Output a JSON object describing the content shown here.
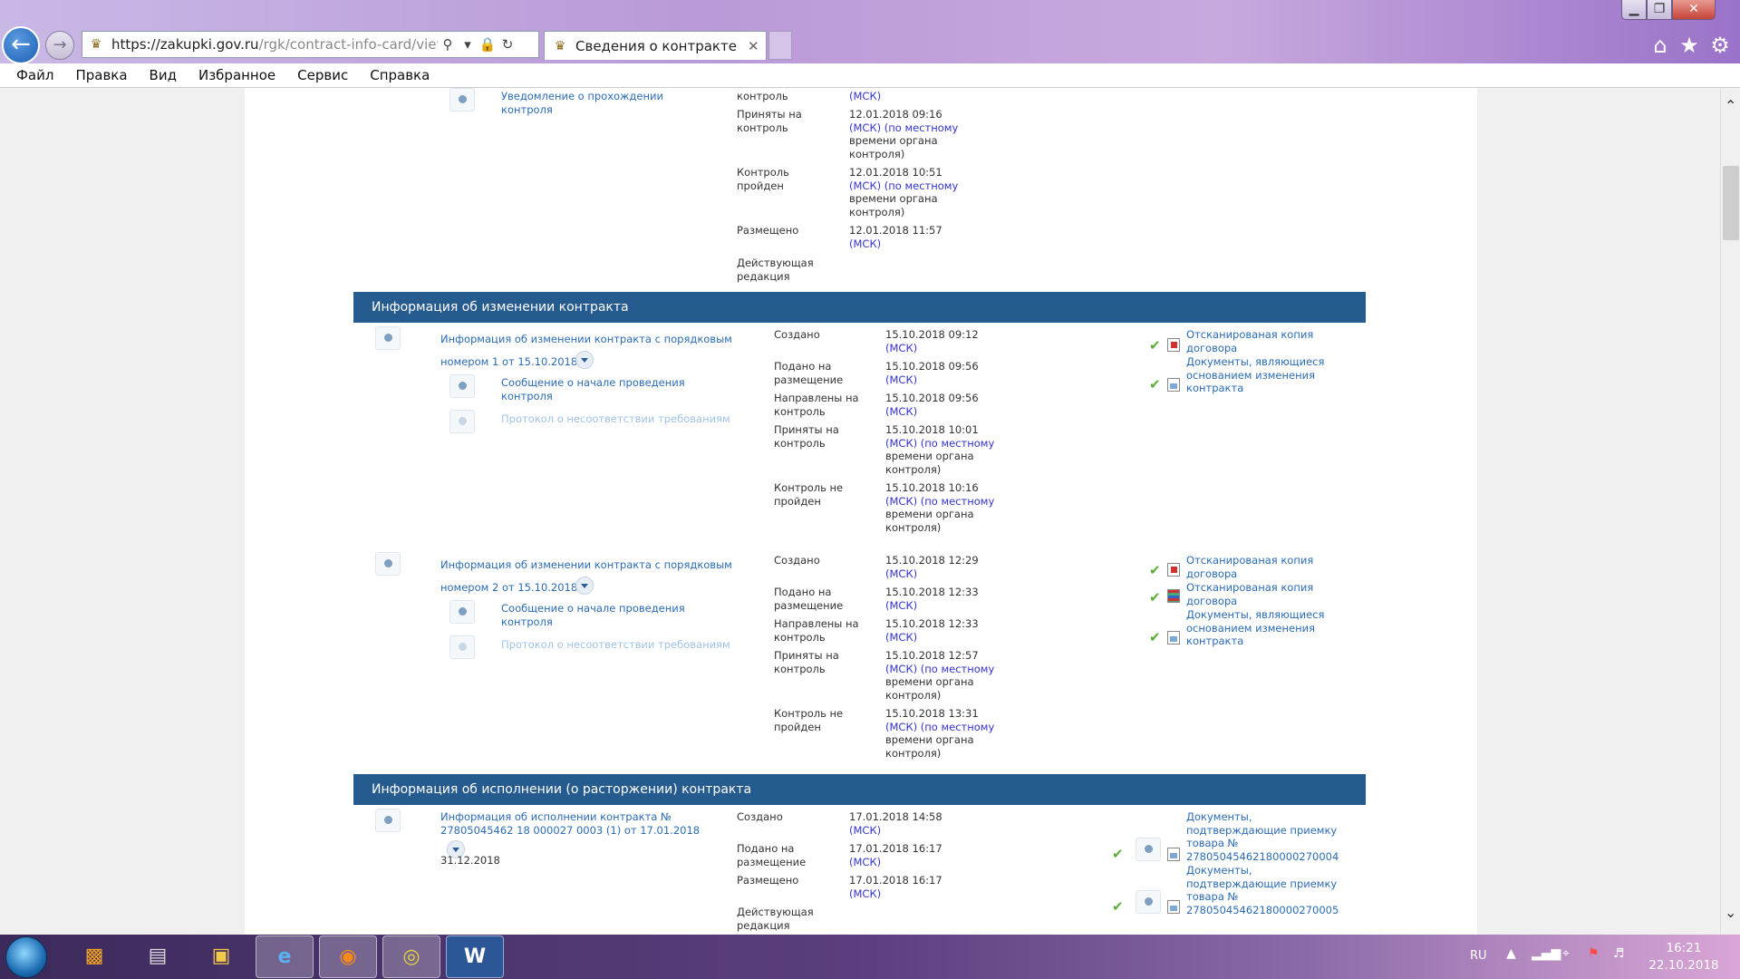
{
  "browser": {
    "url_main": "https://zakupki.gov.ru",
    "url_rest": "/rgk/contract-info-card/view.html?",
    "tab_title": "Сведения о контракте",
    "tab_close": "✕",
    "window": {
      "minimize": "▁",
      "maximize": "❐",
      "close": "✕"
    },
    "icons": {
      "back": "back-arrow-icon",
      "forward": "forward-arrow-icon",
      "search": "search-icon",
      "lock": "lock-icon",
      "refresh": "refresh-icon",
      "home": "home-icon",
      "favorites": "star-icon",
      "settings": "gear-icon"
    }
  },
  "menu": [
    "Файл",
    "Правка",
    "Вид",
    "Избранное",
    "Сервис",
    "Справка"
  ],
  "top_block": {
    "link": [
      "Уведомление о прохождении",
      "контроля"
    ],
    "rows": [
      {
        "label": [
          "контроль"
        ],
        "value": [
          "(МСК)"
        ]
      },
      {
        "label": [
          "Приняты на",
          "контроль"
        ],
        "value": [
          "12.01.2018 09:16",
          "(МСК) (по местному",
          "времени органа",
          "контроля)"
        ]
      },
      {
        "label": [
          "Контроль",
          "пройден"
        ],
        "value": [
          "12.01.2018 10:51",
          "(МСК) (по местному",
          "времени органа",
          "контроля)"
        ]
      },
      {
        "label": [
          "Размещено"
        ],
        "value": [
          "12.01.2018 11:57",
          "(МСК)"
        ]
      },
      {
        "label": [
          "Действующая",
          "редакция"
        ],
        "value": []
      }
    ]
  },
  "section1": {
    "title": "Информация об изменении контракта",
    "items": [
      {
        "title": [
          "Информация об изменении контракта с порядковым",
          "номером 1 от 15.10.2018"
        ],
        "sub1": [
          "Сообщение о начале проведения",
          "контроля"
        ],
        "sub2": "Протокол о несоответствии требованиям",
        "rows": [
          {
            "label": [
              "Создано"
            ],
            "value": [
              "15.10.2018 09:12",
              "(МСК)"
            ]
          },
          {
            "label": [
              "Подано на",
              "размещение"
            ],
            "value": [
              "15.10.2018 09:56",
              "(МСК)"
            ]
          },
          {
            "label": [
              "Направлены на",
              "контроль"
            ],
            "value": [
              "15.10.2018 09:56",
              "(МСК)"
            ]
          },
          {
            "label": [
              "Приняты на",
              "контроль"
            ],
            "value": [
              "15.10.2018 10:01",
              "(МСК) (по местному",
              "времени органа",
              "контроля)"
            ]
          },
          {
            "label": [
              "Контроль не",
              "пройден"
            ],
            "value": [
              "15.10.2018 10:16",
              "(МСК) (по местному",
              "времени органа",
              "контроля)"
            ]
          }
        ],
        "docs": [
          {
            "text": [
              "Отсканированая копия",
              "договора"
            ]
          },
          {
            "text": [
              "Документы, являющиеся",
              "основанием изменения",
              "контракта"
            ]
          }
        ]
      },
      {
        "title": [
          "Информация об изменении контракта с порядковым",
          "номером 2 от 15.10.2018"
        ],
        "sub1": [
          "Сообщение о начале проведения",
          "контроля"
        ],
        "sub2": "Протокол о несоответствии требованиям",
        "rows": [
          {
            "label": [
              "Создано"
            ],
            "value": [
              "15.10.2018 12:29",
              "(МСК)"
            ]
          },
          {
            "label": [
              "Подано на",
              "размещение"
            ],
            "value": [
              "15.10.2018 12:33",
              "(МСК)"
            ]
          },
          {
            "label": [
              "Направлены на",
              "контроль"
            ],
            "value": [
              "15.10.2018 12:33",
              "(МСК)"
            ]
          },
          {
            "label": [
              "Приняты на",
              "контроль"
            ],
            "value": [
              "15.10.2018 12:57",
              "(МСК) (по местному",
              "времени органа",
              "контроля)"
            ]
          },
          {
            "label": [
              "Контроль не",
              "пройден"
            ],
            "value": [
              "15.10.2018 13:31",
              "(МСК) (по местному",
              "времени органа",
              "контроля)"
            ]
          }
        ],
        "docs": [
          {
            "text": [
              "Отсканированая копия",
              "договора"
            ]
          },
          {
            "text": [
              "Отсканированая копия",
              "договора"
            ]
          },
          {
            "text": [
              "Документы, являющиеся",
              "основанием изменения",
              "контракта"
            ]
          }
        ]
      }
    ]
  },
  "section2": {
    "title": "Информация об исполнении (о расторжении) контракта",
    "item": {
      "title": [
        "Информация об исполнении контракта №",
        "27805045462 18 000027 0003 (1) от 17.01.2018"
      ],
      "date": "31.12.2018",
      "rows": [
        {
          "label": [
            "Создано"
          ],
          "value": [
            "17.01.2018 14:58",
            "(МСК)"
          ]
        },
        {
          "label": [
            "Подано на",
            "размещение"
          ],
          "value": [
            "17.01.2018 16:17",
            "(МСК)"
          ]
        },
        {
          "label": [
            "Размещено"
          ],
          "value": [
            "17.01.2018 16:17",
            "(МСК)"
          ]
        },
        {
          "label": [
            "Действующая",
            "редакция"
          ],
          "value": []
        }
      ],
      "docs": [
        {
          "text": [
            "Документы,",
            "подтверждающие приемку",
            "товара №",
            "27805045462180000270004"
          ]
        },
        {
          "text": [
            "Документы,",
            "подтверждающие приемку",
            "товара №",
            "27805045462180000270005"
          ]
        }
      ]
    }
  },
  "taskbar": {
    "lang": "RU",
    "time": "16:21",
    "date": "22.10.2018",
    "apps": [
      "start-orb-icon",
      "app-launcher-icon",
      "scanner-icon",
      "folder-icon",
      "ie-icon",
      "firefox-icon",
      "chrome-icon",
      "word-icon"
    ]
  }
}
